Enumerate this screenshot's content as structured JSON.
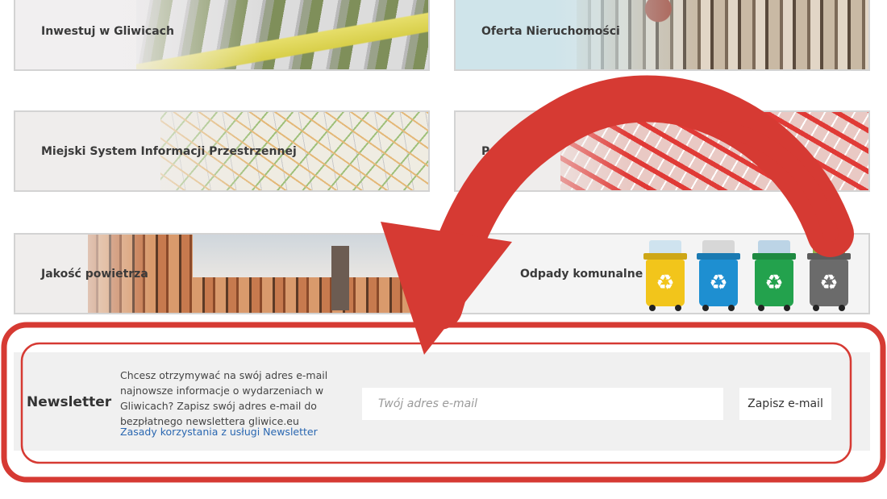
{
  "tiles": [
    {
      "label": "Inwestuj w Gliwicach"
    },
    {
      "label": "Oferta Nieruchomości"
    },
    {
      "label": "Miejski System Informacji Przestrzennej"
    },
    {
      "label": "Portal"
    },
    {
      "label": "Jakość powietrza"
    },
    {
      "label": "Odpady komunalne"
    }
  ],
  "bins": [
    {
      "color": "#f2c51b",
      "icon": "recycle-icon"
    },
    {
      "color": "#1e8fd1",
      "icon": "recycle-icon"
    },
    {
      "color": "#23a24d",
      "icon": "recycle-icon"
    },
    {
      "color": "#6b6b6b",
      "icon": "recycle-icon"
    }
  ],
  "newsletter": {
    "title": "Newsletter",
    "description": "Chcesz otrzymywać na swój adres e-mail najnowsze informacje o wydarzeniach w Gliwicach? Zapisz swój adres e-mail do bezpłatnego newslettera gliwice.eu",
    "link": "Zasady korzystania z usługi Newsletter",
    "input_value": "",
    "input_placeholder": "Twój adres e-mail",
    "button_label": "Zapisz e-mail"
  },
  "colors": {
    "annotation_red": "#d63a33",
    "link_blue": "#2a67b1",
    "panel_bg": "#f0f0f0"
  }
}
